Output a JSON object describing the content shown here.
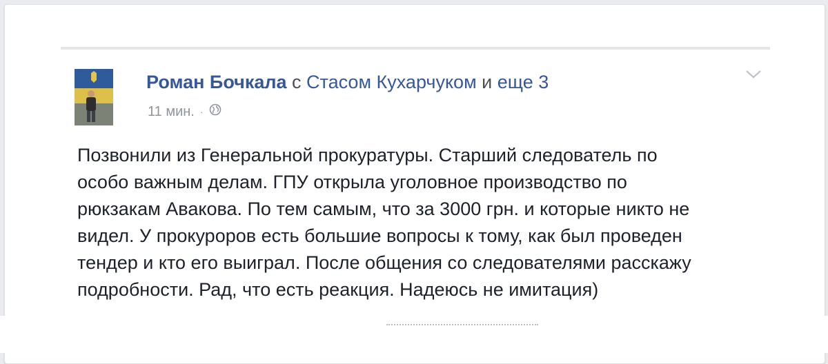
{
  "post": {
    "author": "Роман Бочкала",
    "with_word": "с",
    "tagged_person": "Стасом Кухарчуком",
    "and_word": "и",
    "others": "еще 3",
    "timestamp": "11 мин.",
    "separator": "·",
    "privacy_icon": "globe-icon",
    "menu_icon": "chevron-down-icon",
    "text_lines": [
      "Позвонили из Генеральной прокуратуры. Старший следователь по",
      "особо важным делам. ГПУ открыла уголовное производство по",
      "рюкзакам Авакова. По тем самым, что за 3000 грн. и которые никто не",
      "видел. У прокуроров есть большие вопросы к тому, как был проведен",
      "тендер и кто его выиграл. После общения со следователями расскажу",
      "подробности. Рад, что есть реакция. Надеюсь не имитация)"
    ]
  },
  "colors": {
    "link": "#365899",
    "text": "#1d2129",
    "meta": "#90949c",
    "background": "#e9ebee",
    "card": "#ffffff"
  }
}
